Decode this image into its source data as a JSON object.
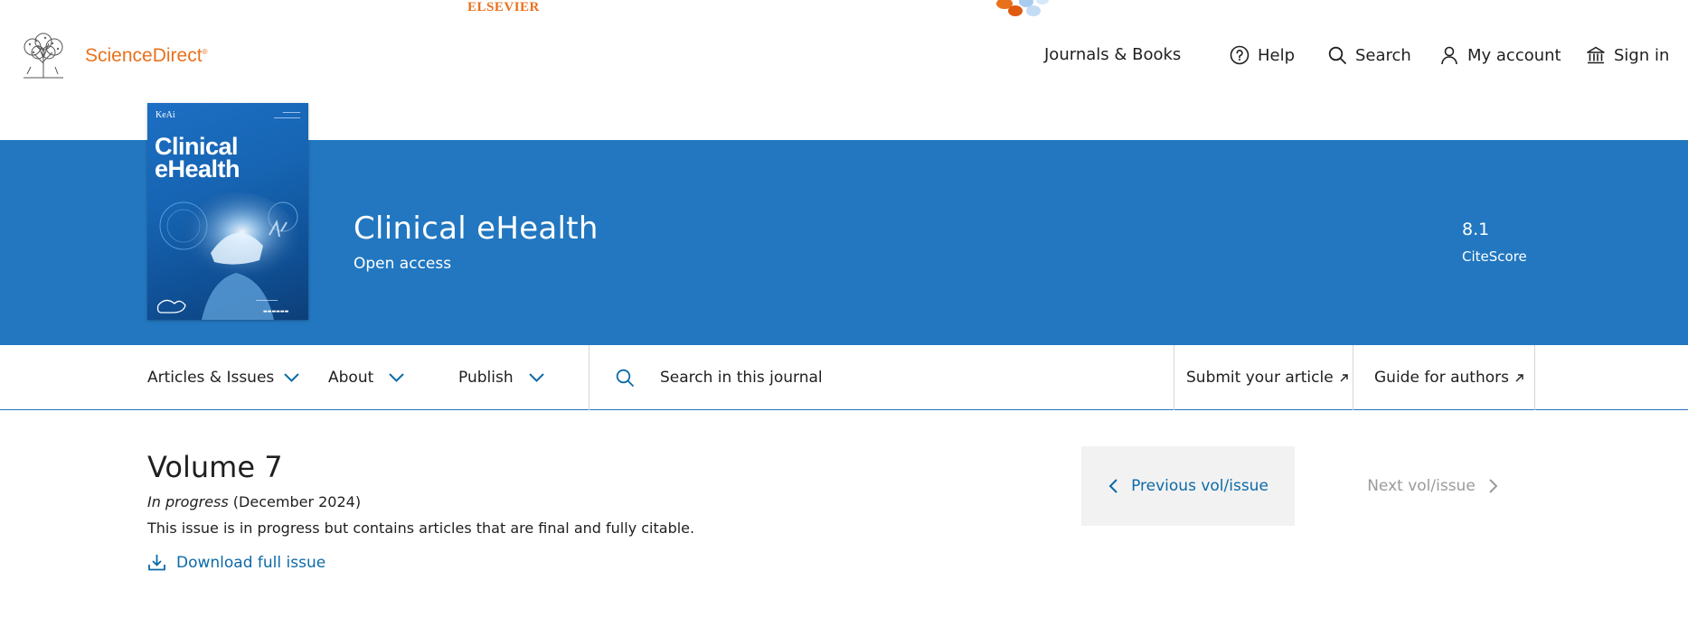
{
  "brand": {
    "publisher_wordmark": "ELSEVIER",
    "site_name": "ScienceDirect",
    "site_name_mark": "®"
  },
  "header_nav": [
    {
      "label": "Journals & Books",
      "icon": null
    },
    {
      "label": "Help",
      "icon": "help-circle-icon"
    },
    {
      "label": "Search",
      "icon": "search-icon"
    },
    {
      "label": "My account",
      "icon": "person-icon"
    },
    {
      "label": "Sign in",
      "icon": "institution-icon"
    }
  ],
  "journal": {
    "cover": {
      "publisher": "KeAi",
      "title_line1": "Clinical",
      "title_line2": "eHealth"
    },
    "title": "Clinical eHealth",
    "access": "Open access",
    "citescore_value": "8.1",
    "citescore_label": "CiteScore"
  },
  "subnav": {
    "menus": [
      "Articles & Issues",
      "About",
      "Publish"
    ],
    "search_placeholder": "Search in this journal",
    "links": [
      "Submit your article",
      "Guide for authors"
    ]
  },
  "volume": {
    "title": "Volume 7",
    "status_italic": "In progress",
    "status_date": " (December 2024)",
    "note": "This issue is in progress but contains articles that are final and fully citable.",
    "download_label": "Download full issue",
    "prev_label": "Previous vol/issue",
    "next_label": "Next vol/issue"
  },
  "colors": {
    "banner": "#2277c0",
    "link": "#0c6aa8",
    "brand_orange": "#e9711c"
  }
}
